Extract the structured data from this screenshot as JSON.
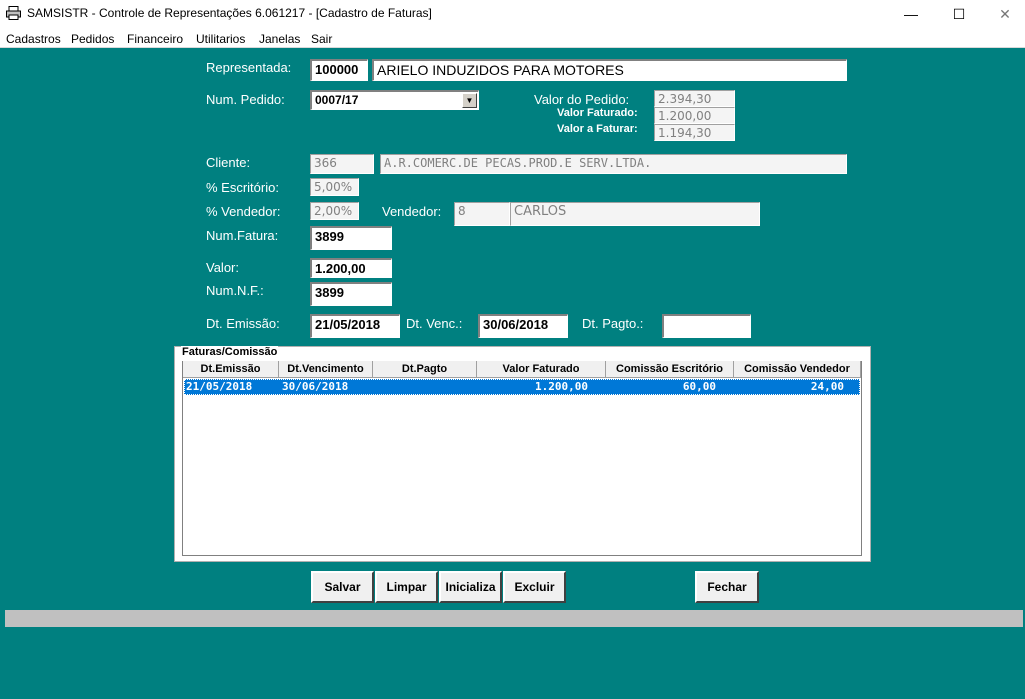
{
  "window": {
    "title": "SAMSISTR - Controle de Representações  6.061217 - [Cadastro de Faturas]",
    "minimize_glyph": "—",
    "maximize_glyph": "☐",
    "close_glyph": "✕",
    "app_icon": "printer-icon"
  },
  "menu": [
    "Cadastros",
    "Pedidos",
    "Financeiro",
    "Utilitarios",
    "Janelas",
    "Sair"
  ],
  "form": {
    "representada_label": "Representada:",
    "representada_code": "100000",
    "representada_name": "ARIELO INDUZIDOS PARA MOTORES",
    "num_pedido_label": "Num. Pedido:",
    "num_pedido_value": "0007/17",
    "valor_pedido_label": "Valor do Pedido:",
    "valor_pedido_value": "2.394,30",
    "valor_faturado_label": "Valor Faturado:",
    "valor_faturado_value": "1.200,00",
    "valor_a_faturar_label": "Valor a Faturar:",
    "valor_a_faturar_value": "1.194,30",
    "cliente_label": "Cliente:",
    "cliente_code": "366",
    "cliente_name": "A.R.COMERC.DE PECAS.PROD.E SERV.LTDA.",
    "escritorio_label": "% Escritório:",
    "escritorio_value": "5,00%",
    "vendedor_pct_label": "% Vendedor:",
    "vendedor_pct_value": "2,00%",
    "vendedor_label": "Vendedor:",
    "vendedor_code": "8",
    "vendedor_name": "CARLOS",
    "num_fatura_label": "Num.Fatura:",
    "num_fatura_value": "3899",
    "valor_label": "Valor:",
    "valor_value": "1.200,00",
    "num_nf_label": "Num.N.F.:",
    "num_nf_value": "3899",
    "dt_emissao_label": "Dt. Emissão:",
    "dt_emissao_value": "21/05/2018",
    "dt_venc_label": "Dt. Venc.:",
    "dt_venc_value": "30/06/2018",
    "dt_pagto_label": "Dt. Pagto.:",
    "dt_pagto_value": ""
  },
  "grid": {
    "caption": "Faturas/Comissão",
    "columns": [
      "Dt.Emissão",
      "Dt.Vencimento",
      "Dt.Pagto",
      "Valor Faturado",
      "Comissão Escritório",
      "Comissão Vendedor"
    ],
    "rows": [
      [
        "21/05/2018",
        "30/06/2018",
        "",
        "1.200,00",
        "60,00",
        "24,00"
      ]
    ]
  },
  "buttons": {
    "salvar": "Salvar",
    "limpar": "Limpar",
    "inicializa": "Inicializa",
    "excluir": "Excluir",
    "fechar": "Fechar"
  },
  "colors": {
    "background": "#008080",
    "selection": "#0078d7"
  }
}
